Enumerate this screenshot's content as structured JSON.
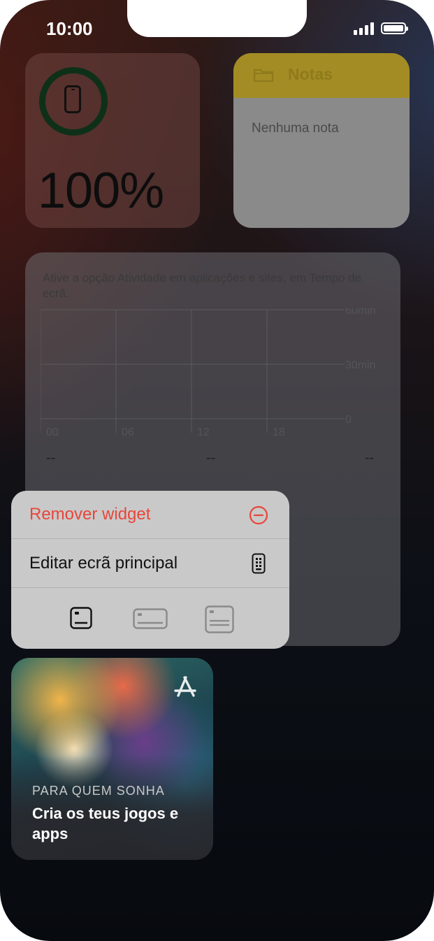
{
  "status_bar": {
    "time": "10:00"
  },
  "battery_widget": {
    "percent": "100%",
    "level": 1.0,
    "device_icon": "iphone-icon"
  },
  "notes_widget": {
    "title": "Notas",
    "empty_text": "Nenhuma nota",
    "icon": "folder-icon"
  },
  "screen_time_widget": {
    "message": "Ative a opção Atividade em aplicações e sites, em Tempo de ecrã.",
    "y_labels": [
      "60min",
      "30min",
      "0"
    ],
    "x_labels": [
      "00",
      "06",
      "12",
      "18"
    ],
    "summary_values": [
      "--",
      "--",
      "--"
    ]
  },
  "context_menu": {
    "remove_label": "Remover widget",
    "remove_icon": "minus-circle-icon",
    "edit_label": "Editar ecrã principal",
    "edit_icon": "home-screen-icon",
    "sizes": [
      {
        "name": "small-widget-size-icon",
        "selected": true
      },
      {
        "name": "medium-widget-size-icon",
        "selected": false
      },
      {
        "name": "large-widget-size-icon",
        "selected": false
      }
    ],
    "remove_color": "#ff3b30"
  },
  "app_store_widget": {
    "eyebrow": "PARA QUEM SONHA",
    "title": "Cria os teus jogos e apps",
    "icon": "app-store-icon"
  }
}
